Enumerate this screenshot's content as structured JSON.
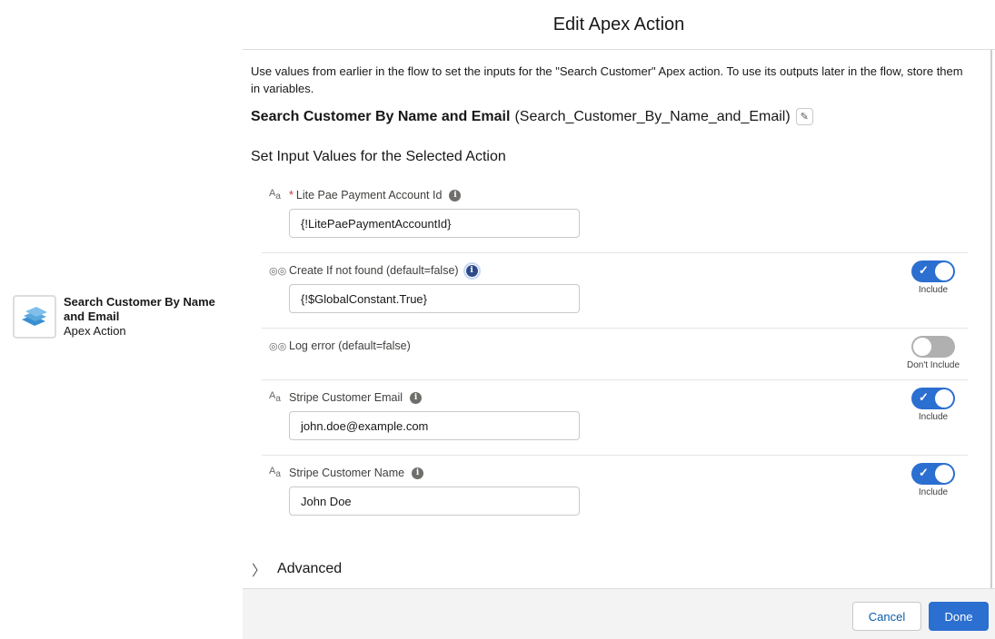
{
  "canvas_node": {
    "title": "Search Customer By Name and Email",
    "subtitle": "Apex Action",
    "icon": "apex-action-layers-icon"
  },
  "modal": {
    "title": "Edit Apex Action",
    "description": "Use values from earlier in the flow to set the inputs for the \"Search Customer\" Apex action. To use its outputs later in the flow, store them in variables.",
    "action_label": "Search Customer By Name and Email",
    "action_api_name": "(Search_Customer_By_Name_and_Email)",
    "section_title": "Set Input Values for the Selected Action",
    "inputs": [
      {
        "type_icon": "text-type-icon",
        "required": "*",
        "label": "Lite Pae Payment Account Id",
        "value": "{!LitePaePaymentAccountId}"
      },
      {
        "type_icon": "boolean-type-icon",
        "label": "Create If not found (default=false)",
        "value": "{!$GlobalConstant.True}",
        "toggle": "Include",
        "included": true
      },
      {
        "type_icon": "boolean-type-icon",
        "label": "Log error (default=false)",
        "toggle": "Don't Include",
        "included": false
      },
      {
        "type_icon": "text-type-icon",
        "label": "Stripe Customer Email",
        "value": "john.doe@example.com",
        "toggle": "Include",
        "included": true
      },
      {
        "type_icon": "text-type-icon",
        "label": "Stripe Customer Name",
        "value": "John Doe",
        "toggle": "Include",
        "included": true
      }
    ],
    "advanced_label": "Advanced",
    "cancel_label": "Cancel",
    "done_label": "Done"
  },
  "colors": {
    "brand": "#2b6fd0",
    "required": "#c23934"
  }
}
